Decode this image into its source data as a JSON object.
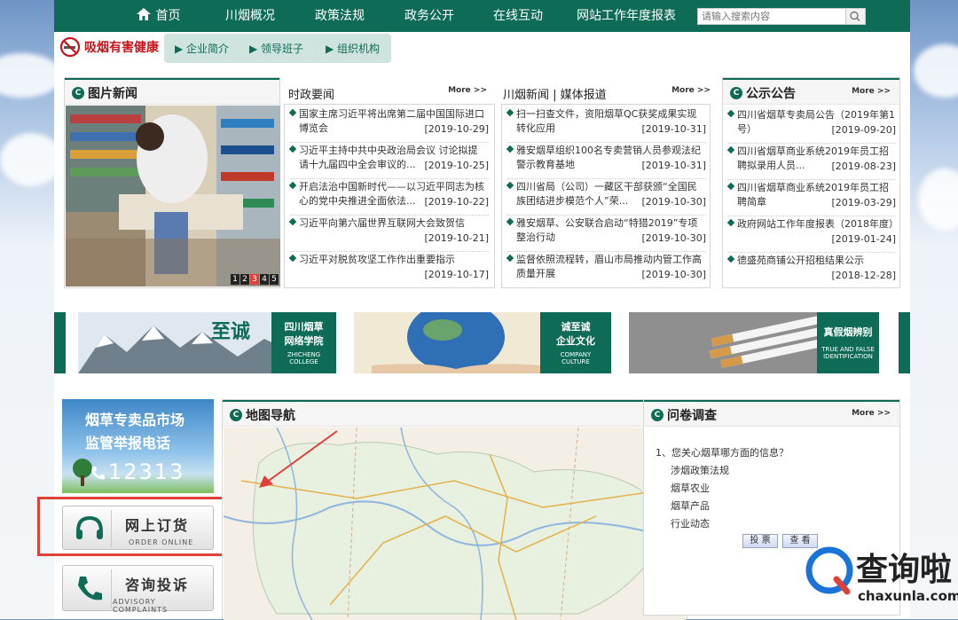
{
  "nav": {
    "home": "首页",
    "items": [
      "川烟概况",
      "政策法规",
      "政务公开",
      "在线互动",
      "网站工作年度报表"
    ],
    "search_placeholder": "请输入搜索内容"
  },
  "slogan": "吸烟有害健康",
  "subnav": [
    "企业简介",
    "领导班子",
    "组织机构"
  ],
  "photo_news": {
    "title": "图片新闻",
    "pager": [
      "1",
      "2",
      "3",
      "4",
      "5"
    ],
    "active_page": 3
  },
  "politics": {
    "title": "时政要闻",
    "more": "More  >>",
    "items": [
      {
        "text": "国家主席习近平将出席第二届中国国际进口博览会",
        "date": "[2019-10-29]"
      },
      {
        "text": "习近平主持中共中央政治局会议 讨论拟提请十九届四中全会审议的...",
        "date": "[2019-10-25]"
      },
      {
        "text": "开启法治中国新时代——以习近平同志为核心的党中央推进全面依法...",
        "date": "[2019-10-22]"
      },
      {
        "text": "习近平向第六届世界互联网大会致贺信",
        "date": "[2019-10-21]"
      },
      {
        "text": "习近平对脱贫攻坚工作作出重要指示",
        "date": "[2019-10-17]"
      }
    ]
  },
  "sichuan": {
    "title": "川烟新闻 | 媒体报道",
    "more": "More  >>",
    "items": [
      {
        "text": "扫一扫查文件，资阳烟草QC获奖成果实现转化应用",
        "date": "[2019-10-31]"
      },
      {
        "text": "雅安烟草组织100名专卖营销人员参观法纪警示教育基地",
        "date": "[2019-10-31]"
      },
      {
        "text": "四川省局（公司）一藏区干部获颁“全国民族团结进步模范个人”荣...",
        "date": "[2019-10-30]"
      },
      {
        "text": "雅安烟草、公安联合启动“特猎2019”专项整治行动",
        "date": "[2019-10-30]"
      },
      {
        "text": "监督依照流程转，眉山市局推动内管工作高质量开展",
        "date": "[2019-10-30]"
      }
    ]
  },
  "notice": {
    "title": "公示公告",
    "more": "More  >>",
    "items": [
      {
        "text": "四川省烟草专卖局公告（2019年第1号）",
        "date": "[2019-09-20]"
      },
      {
        "text": "四川省烟草商业系统2019年员工招聘拟录用人员...",
        "date": "[2019-08-23]"
      },
      {
        "text": "四川省烟草商业系统2019年员工招聘简章",
        "date": "[2019-03-29]"
      },
      {
        "text": "政府网站工作年度报表（2018年度）",
        "date": "[2019-01-24]"
      },
      {
        "text": "德盛苑商铺公开招租结果公示",
        "date": "[2018-12-28]"
      }
    ]
  },
  "banners": [
    {
      "logo": "至诚",
      "cn1": "四川烟草",
      "cn2": "网络学院",
      "en1": "ZHICHENG",
      "en2": "COLLEGE"
    },
    {
      "cn1": "诚至诚",
      "cn2": "企业文化",
      "en1": "COMPANY",
      "en2": "CULTURE"
    },
    {
      "cn1": "真假烟辨别",
      "en1": "TRUE AND FALSE",
      "en2": "IDENTIFICATION"
    }
  ],
  "report": {
    "line1": "烟草专卖品市场",
    "line2": "监管举报电话",
    "phone": "12313"
  },
  "order": {
    "label": "网上订货",
    "sub": "ORDER ONLINE"
  },
  "advisory": {
    "label": "咨询投诉",
    "sub": "ADVISORY COMPLAINTS"
  },
  "map": {
    "title": "地图导航"
  },
  "survey": {
    "title": "问卷调查",
    "more": "More  >>",
    "question": "1、您关心烟草哪方面的信息？",
    "options": [
      "涉烟政策法规",
      "烟草农业",
      "烟草产品",
      "行业动态"
    ],
    "vote": "投 票",
    "view": "查 看"
  },
  "watermark": {
    "brand": "查询啦",
    "url": "chaxunla.com"
  },
  "colors": {
    "brand_green": "#0e6b55",
    "highlight_red": "#e0403a",
    "slogan_red": "#c8151b"
  }
}
